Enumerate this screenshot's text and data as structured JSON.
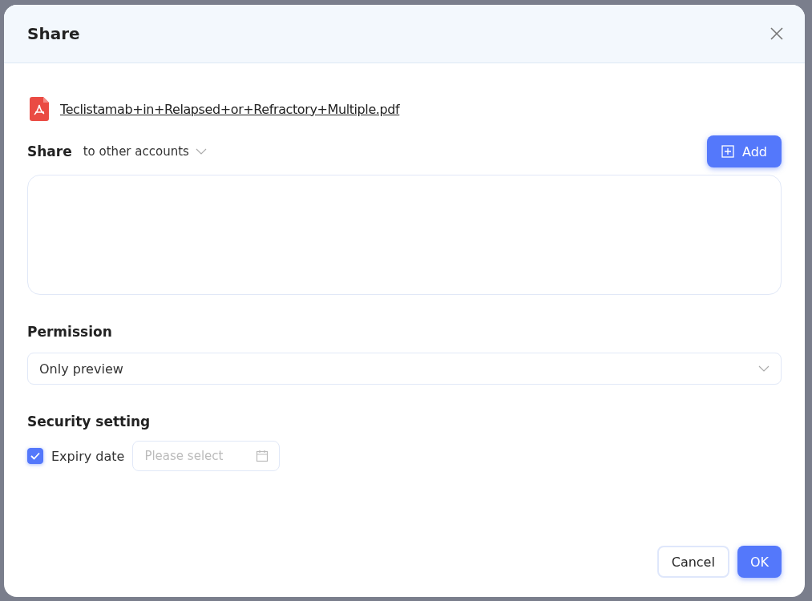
{
  "dialog": {
    "title": "Share"
  },
  "file": {
    "name": "Teclistamab+in+Relapsed+or+Refractory+Multiple.pdf"
  },
  "share": {
    "label": "Share",
    "target": "to other accounts",
    "add_button": "Add"
  },
  "permission": {
    "label": "Permission",
    "value": "Only preview"
  },
  "security": {
    "label": "Security setting",
    "expiry": {
      "label": "Expiry date",
      "checked": true,
      "placeholder": "Please select"
    }
  },
  "buttons": [
    {
      "label": "Cancel",
      "kind": "secondary"
    },
    {
      "label": "OK",
      "kind": "primary"
    }
  ]
}
